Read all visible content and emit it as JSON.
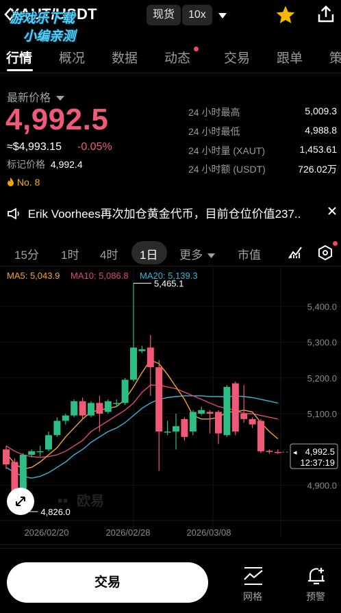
{
  "header": {
    "pair": "XAUT/USDT",
    "watermark_line1": "游戏乐下载",
    "watermark_line2": "小编亲测",
    "spot_label": "现货",
    "leverage_label": "10x"
  },
  "tabs": [
    {
      "label": "行情",
      "active": true
    },
    {
      "label": "概况",
      "active": false
    },
    {
      "label": "数据",
      "active": false
    },
    {
      "label": "动态",
      "active": false,
      "dot": true
    },
    {
      "label": "交易",
      "active": false
    },
    {
      "label": "跟单",
      "active": false
    },
    {
      "label": "策",
      "active": false
    }
  ],
  "price": {
    "label": "最新价格",
    "last": "4,992.5",
    "usd": "≈$4,993.15",
    "change": "-0.05%",
    "mark_label": "标记价格",
    "mark_value": "4,992.4",
    "rank": "No. 8"
  },
  "stats": [
    {
      "label": "24 小时最高",
      "value": "5,009.3"
    },
    {
      "label": "24 小时最低",
      "value": "4,988.8"
    },
    {
      "label": "24 小时量 (XAUT)",
      "value": "1,453.61"
    },
    {
      "label": "24 小时额 (USDT)",
      "value": "726.02万"
    }
  ],
  "news": {
    "text": "Erik Voorhees再次加仓黄金代币，目前仓位价值237.."
  },
  "toolbar": {
    "intervals": [
      "15分",
      "1时",
      "4时",
      "1日"
    ],
    "active_interval": "1日",
    "more_label": "更多",
    "market_cap_label": "市值"
  },
  "indicators": {
    "ma5": "MA5: 5,043.9",
    "ma10": "MA10: 5,086.8",
    "ma20": "MA20: 5,139.3"
  },
  "colors": {
    "up": "#2ebd85",
    "down": "#f05a78",
    "ma5": "#f4a623",
    "ma10": "#e0487a",
    "ma20": "#36b6d8",
    "accent_star": "#f7b500"
  },
  "chart_data": {
    "type": "candlestick",
    "y_ticks": [
      "5,400.0",
      "5,300.0",
      "5,200.0",
      "5,100.0",
      "5,000.0",
      "4,900.0"
    ],
    "x_ticks": [
      "2026/02/20",
      "2026/02/28",
      "2026/03/08"
    ],
    "ylim": [
      4805,
      5510
    ],
    "high_label": "5,465.1",
    "low_label": "4,826.0",
    "current_price": "4,992.5",
    "countdown": "12:37:19",
    "exchange_watermark": "欧易",
    "candles": [
      {
        "o": 5000,
        "h": 5010,
        "c": 4958,
        "l": 4945
      },
      {
        "o": 4965,
        "h": 4975,
        "c": 4880,
        "l": 4826
      },
      {
        "o": 4880,
        "h": 4990,
        "c": 4985,
        "l": 4875
      },
      {
        "o": 4985,
        "h": 5000,
        "c": 4995,
        "l": 4978
      },
      {
        "o": 4995,
        "h": 5010,
        "c": 4995,
        "l": 4980
      },
      {
        "o": 5000,
        "h": 5050,
        "c": 5040,
        "l": 4995
      },
      {
        "o": 5040,
        "h": 5090,
        "c": 5080,
        "l": 5035
      },
      {
        "o": 5080,
        "h": 5100,
        "c": 5095,
        "l": 5070
      },
      {
        "o": 5095,
        "h": 5140,
        "c": 5135,
        "l": 5090
      },
      {
        "o": 5135,
        "h": 5145,
        "c": 5095,
        "l": 5085
      },
      {
        "o": 5095,
        "h": 5135,
        "c": 5130,
        "l": 5090
      },
      {
        "o": 5130,
        "h": 5150,
        "c": 5100,
        "l": 5050
      },
      {
        "o": 5105,
        "h": 5140,
        "c": 5135,
        "l": 5100
      },
      {
        "o": 5130,
        "h": 5140,
        "c": 5130,
        "l": 5120
      },
      {
        "o": 5130,
        "h": 5200,
        "c": 5195,
        "l": 5125
      },
      {
        "o": 5195,
        "h": 5465,
        "c": 5285,
        "l": 5190
      },
      {
        "o": 5275,
        "h": 5290,
        "c": 5280,
        "l": 5270
      },
      {
        "o": 5285,
        "h": 5320,
        "c": 5230,
        "l": 5150
      },
      {
        "o": 5230,
        "h": 5250,
        "c": 5050,
        "l": 4940
      },
      {
        "o": 5050,
        "h": 5080,
        "c": 5050,
        "l": 5040
      },
      {
        "o": 5050,
        "h": 5100,
        "c": 5065,
        "l": 5000
      },
      {
        "o": 5085,
        "h": 5090,
        "c": 5035,
        "l": 5025
      },
      {
        "o": 5050,
        "h": 5110,
        "c": 5105,
        "l": 5040
      },
      {
        "o": 5100,
        "h": 5120,
        "c": 5110,
        "l": 5095
      },
      {
        "o": 5105,
        "h": 5110,
        "c": 5100,
        "l": 5045
      },
      {
        "o": 5105,
        "h": 5110,
        "c": 5045,
        "l": 5015
      },
      {
        "o": 5040,
        "h": 5180,
        "c": 5175,
        "l": 5035
      },
      {
        "o": 5185,
        "h": 5190,
        "c": 5050,
        "l": 5040
      },
      {
        "o": 5100,
        "h": 5180,
        "c": 5085,
        "l": 5075
      },
      {
        "o": 5085,
        "h": 5090,
        "c": 5070,
        "l": 5060
      },
      {
        "o": 5080,
        "h": 5085,
        "c": 4995,
        "l": 4990
      },
      {
        "o": 4996,
        "h": 5000,
        "c": 4993,
        "l": 4988
      },
      {
        "o": 4993,
        "h": 5000,
        "c": 4992.5,
        "l": 4988
      }
    ],
    "ma5": [
      4990,
      4960,
      4945,
      4950,
      4965,
      4985,
      5005,
      5035,
      5060,
      5085,
      5105,
      5110,
      5115,
      5120,
      5140,
      5175,
      5215,
      5250,
      5240,
      5210,
      5175,
      5140,
      5095,
      5085,
      5085,
      5090,
      5105,
      5105,
      5110,
      5105,
      5075,
      5050,
      5030
    ],
    "ma10": [
      5010,
      4995,
      4985,
      4980,
      4978,
      4980,
      4985,
      4995,
      5010,
      5025,
      5050,
      5065,
      5080,
      5095,
      5110,
      5130,
      5160,
      5180,
      5180,
      5175,
      5170,
      5160,
      5150,
      5140,
      5130,
      5120,
      5115,
      5110,
      5100,
      5100,
      5095,
      5090,
      5085
    ],
    "ma20": [
      4950,
      4935,
      4925,
      4920,
      4925,
      4935,
      4950,
      4965,
      4985,
      5000,
      5020,
      5035,
      5050,
      5060,
      5075,
      5095,
      5115,
      5130,
      5140,
      5145,
      5148,
      5150,
      5150,
      5150,
      5148,
      5148,
      5147,
      5150,
      5148,
      5145,
      5140,
      5135,
      5130
    ]
  },
  "bottom": {
    "trade_label": "交易",
    "grid_label": "网格",
    "alert_label": "预警"
  }
}
